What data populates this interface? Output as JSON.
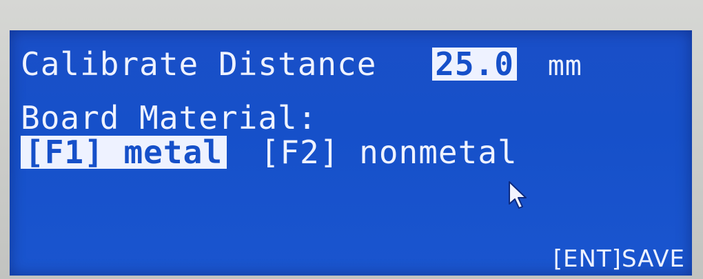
{
  "calibration": {
    "label": "Calibrate Distance",
    "value": "25.0",
    "unit": "mm"
  },
  "board_material": {
    "label": "Board Material:",
    "options": [
      {
        "key": "[F1]",
        "label": "metal",
        "selected": true
      },
      {
        "key": "[F2]",
        "label": "nonmetal",
        "selected": false
      }
    ]
  },
  "footer": {
    "save_hint": "[ENT]SAVE"
  },
  "colors": {
    "screen_bg": "#1650c9",
    "text": "#eef2ff"
  },
  "icons": {
    "pointer": "mouse-pointer-icon"
  }
}
